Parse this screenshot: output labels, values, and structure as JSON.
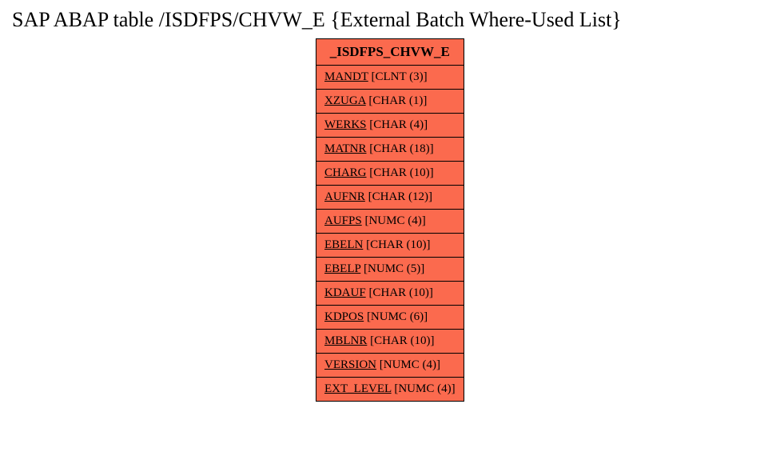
{
  "title": "SAP ABAP table /ISDFPS/CHVW_E {External Batch Where-Used List}",
  "table": {
    "header": "_ISDFPS_CHVW_E",
    "fields": [
      {
        "name": "MANDT",
        "type": "[CLNT (3)]"
      },
      {
        "name": "XZUGA",
        "type": "[CHAR (1)]"
      },
      {
        "name": "WERKS",
        "type": "[CHAR (4)]"
      },
      {
        "name": "MATNR",
        "type": "[CHAR (18)]"
      },
      {
        "name": "CHARG",
        "type": "[CHAR (10)]"
      },
      {
        "name": "AUFNR",
        "type": "[CHAR (12)]"
      },
      {
        "name": "AUFPS",
        "type": "[NUMC (4)]"
      },
      {
        "name": "EBELN",
        "type": "[CHAR (10)]"
      },
      {
        "name": "EBELP",
        "type": "[NUMC (5)]"
      },
      {
        "name": "KDAUF",
        "type": "[CHAR (10)]"
      },
      {
        "name": "KDPOS",
        "type": "[NUMC (6)]"
      },
      {
        "name": "MBLNR",
        "type": "[CHAR (10)]"
      },
      {
        "name": "VERSION",
        "type": "[NUMC (4)]"
      },
      {
        "name": "EXT_LEVEL",
        "type": "[NUMC (4)]"
      }
    ]
  }
}
